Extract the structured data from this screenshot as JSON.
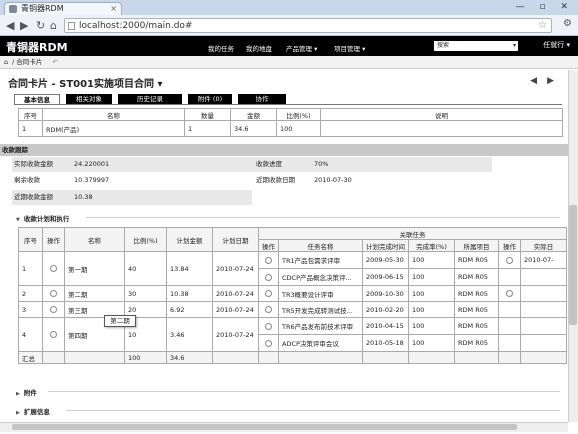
{
  "browser": {
    "tab_title": "青铜器RDM",
    "url": "localhost:2000/main.do#",
    "window_controls": "— ▫ ✕"
  },
  "app": {
    "brand": "青铜器RDM",
    "menu": [
      "我的任务",
      "我的地盘",
      "产品管理 ▾",
      "项目管理 ▾"
    ],
    "search_value": "搜索",
    "user": "任就行 ▾"
  },
  "breadcrumb": "合同卡片",
  "page_title": "合同卡片 - ST001实施项目合同 ▾",
  "tabs": [
    "基本信息",
    "相关对象",
    "历史记录",
    "附件 (0)",
    "协作"
  ],
  "products": {
    "headers": [
      "序号",
      "名称",
      "数量",
      "金额",
      "比例(%)",
      "说明"
    ],
    "rows": [
      [
        "1",
        "RDM(产品)",
        "1",
        "34.6",
        "100",
        ""
      ]
    ]
  },
  "receipt": {
    "section_title": "收款跟踪",
    "fields": [
      {
        "label": "实际收款金额",
        "value": "24.220001"
      },
      {
        "label": "收款进度",
        "value": "70%"
      },
      {
        "label": "剩余收款",
        "value": "10.379997"
      },
      {
        "label": "近期收款日期",
        "value": "2010-07-30"
      },
      {
        "label": "近期收款金额",
        "value": "10.38"
      }
    ]
  },
  "plan": {
    "section_title": "收款计划和执行",
    "group_header": "关联任务",
    "headers": [
      "序号",
      "操作",
      "名称",
      "比例(%)",
      "计划金额",
      "计划日期",
      "操作",
      "任务名称",
      "计划完成时间",
      "完成率(%)",
      "所属项目",
      "操作",
      "实际日"
    ],
    "rows": [
      {
        "no": "1",
        "name": "第一期",
        "ratio": "40",
        "amount": "13.84",
        "date": "2010-07-24",
        "tasks": [
          {
            "task": "TR1产品包需求评审",
            "finish": "2009-05-30",
            "rate": "100",
            "project": "RDM R05",
            "actual": "2010-07-"
          },
          {
            "task": "CDCP产品概念决策评...",
            "finish": "2009-06-15",
            "rate": "100",
            "project": "RDM R05",
            "actual": ""
          }
        ]
      },
      {
        "no": "2",
        "name": "第二期",
        "ratio": "30",
        "amount": "10.38",
        "date": "2010-07-24",
        "tasks": [
          {
            "task": "TR3概要设计评审",
            "finish": "2009-10-30",
            "rate": "100",
            "project": "RDM R05",
            "actual": ""
          }
        ]
      },
      {
        "no": "3",
        "name": "第三期",
        "ratio": "20",
        "amount": "6.92",
        "date": "2010-07-24",
        "tasks": [
          {
            "task": "TR5开发完成转测试技...",
            "finish": "2010-02-20",
            "rate": "100",
            "project": "RDM R05",
            "actual": ""
          }
        ]
      },
      {
        "no": "4",
        "name": "第四期",
        "ratio": "10",
        "amount": "3.46",
        "date": "2010-07-24",
        "tasks": [
          {
            "task": "TR6产品发布前技术评审",
            "finish": "2010-04-15",
            "rate": "100",
            "project": "RDM R05",
            "actual": ""
          },
          {
            "task": "ADCP决策评审会议",
            "finish": "2010-05-18",
            "rate": "100",
            "project": "RDM R05",
            "actual": ""
          }
        ]
      }
    ],
    "summary": {
      "label": "汇总",
      "ratio": "100",
      "amount": "34.6"
    },
    "tooltip": "第二期"
  },
  "folds": [
    "附件",
    "扩展信息"
  ]
}
